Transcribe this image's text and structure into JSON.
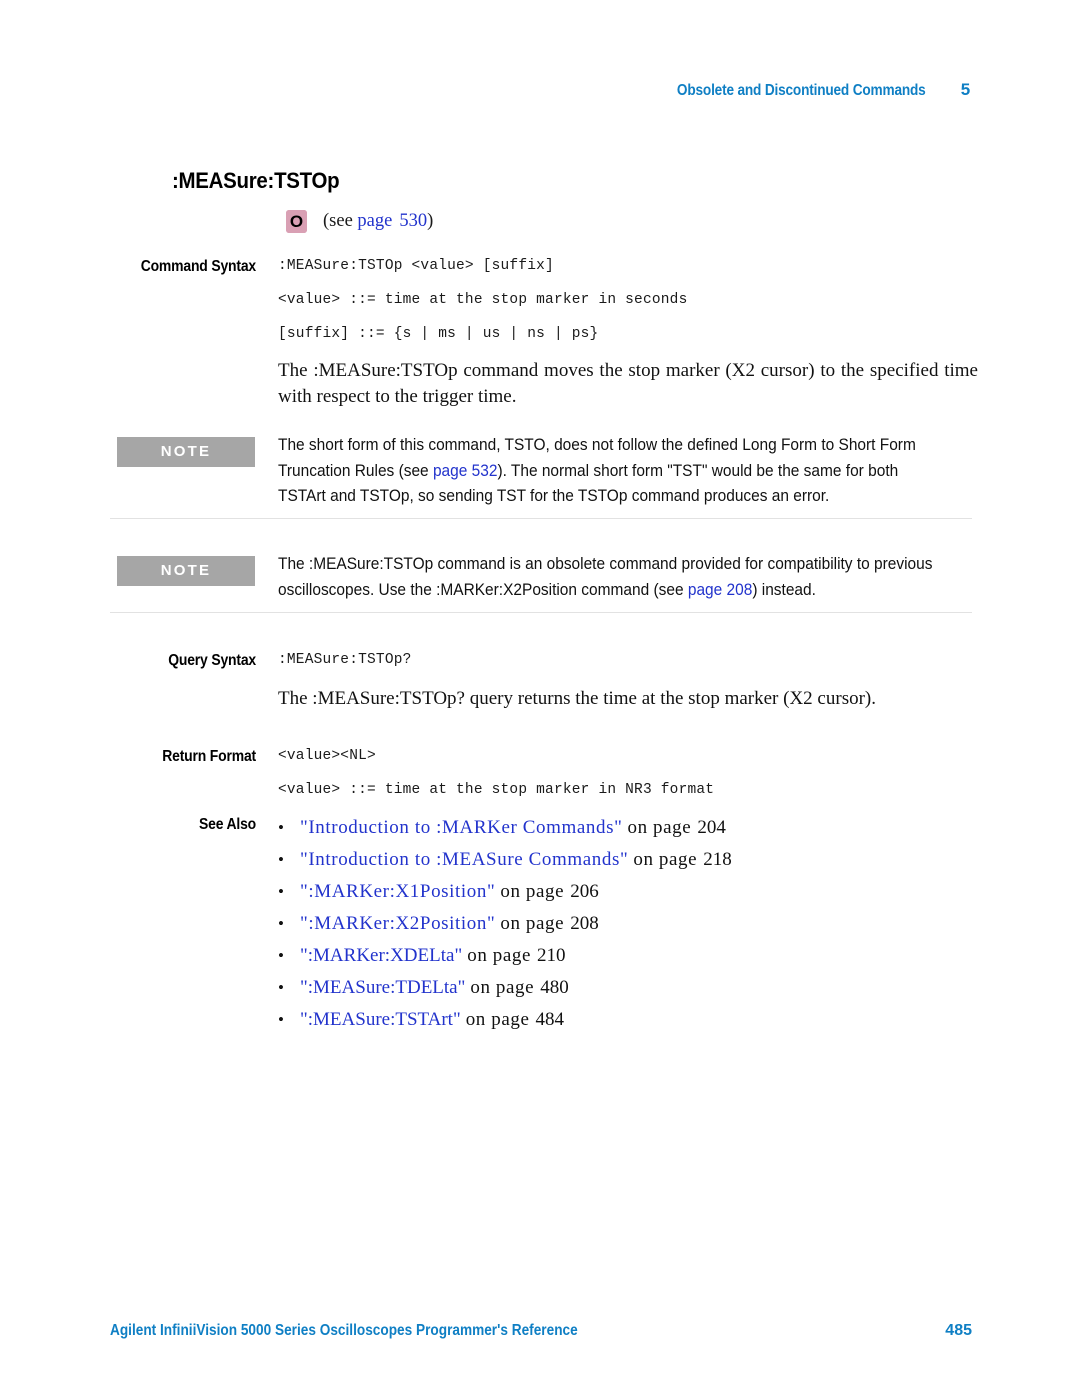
{
  "header": {
    "chapter_title": "Obsolete and Discontinued Commands",
    "chapter_number": "5"
  },
  "section": {
    "title": ":MEASure:TSTOp",
    "obsolete_badge": "O",
    "see_prefix": "(see ",
    "see_link": "page",
    "see_page": "530",
    "see_suffix": ")"
  },
  "command_syntax": {
    "label": "Command Syntax",
    "line1": ":MEASure:TSTOp <value> [suffix]",
    "line2": "<value> ::= time at the stop marker in seconds",
    "line3": "[suffix] ::= {s | ms | us | ns | ps}",
    "description": "The :MEASure:TSTOp command moves the stop marker (X2 cursor) to the specified time with respect to the trigger time."
  },
  "note1": {
    "badge": "NOTE",
    "text_part1": "The short form of this command, TSTO, does not follow the defined Long Form to Short Form Truncation Rules (see ",
    "link": "page 532",
    "text_part2": "). The normal short form \"TST\" would be the same for both TSTArt and TSTOp, so sending TST for the TSTOp command produces an error."
  },
  "note2": {
    "badge": "NOTE",
    "text_part1": "The :MEASure:TSTOp command is an obsolete command provided for compatibility to previous oscilloscopes. Use the :MARKer:X2Position command (see ",
    "link": "page 208",
    "text_part2": ") instead."
  },
  "query_syntax": {
    "label": "Query Syntax",
    "line1": ":MEASure:TSTOp?",
    "description": "The :MEASure:TSTOp? query returns the time at the stop marker (X2 cursor)."
  },
  "return_format": {
    "label": "Return Format",
    "line1": "<value><NL>",
    "line2": "<value> ::= time at the stop marker in NR3 format"
  },
  "see_also": {
    "label": "See Also",
    "bullet": "•",
    "items": [
      {
        "link": "\"Introduction to :MARKer Commands\"",
        "tail": "on page",
        "page": "204",
        "wide": true
      },
      {
        "link": "\"Introduction to :MEASure Commands\"",
        "tail": "on page",
        "page": "218",
        "wide": true
      },
      {
        "link": "\":MARKer:X1Position\"",
        "tail": "on page",
        "page": "206",
        "wide": true
      },
      {
        "link": "\":MARKer:X2Position\"",
        "tail": "on page",
        "page": "208",
        "wide": true
      },
      {
        "link": "\":MARKer:XDELta\"",
        "tail": "on page",
        "page": "210",
        "wide": false
      },
      {
        "link": "\":MEASure:TDELta\"",
        "tail": "on page",
        "page": "480",
        "wide": false
      },
      {
        "link": "\":MEASure:TSTArt\"",
        "tail": "on page",
        "page": "484",
        "wide": false
      }
    ]
  },
  "footer": {
    "left": "Agilent InfiniiVision 5000 Series Oscilloscopes Programmer's Reference",
    "right": "485"
  },
  "colors": {
    "header_blue": "#0f7fc4",
    "link_blue": "#2233cc",
    "note_gray": "#a6a6a6",
    "badge_pink": "#d9a0b4",
    "rule_gray": "#e2e2e2"
  }
}
